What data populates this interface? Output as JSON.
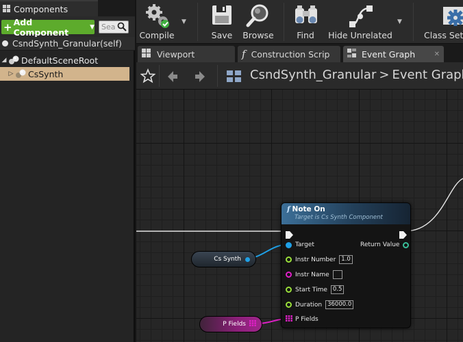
{
  "components_panel": {
    "tab_label": "Components",
    "add_button_label": "Add Component",
    "search_placeholder": "Sea",
    "self_row_label": "CsndSynth_Granular(self)",
    "tree": [
      {
        "label": "DefaultSceneRoot"
      },
      {
        "label": "CsSynth",
        "selected": true
      }
    ]
  },
  "toolbar": {
    "buttons": [
      {
        "label": "Compile",
        "icon": "compile-gears-icon"
      },
      {
        "label": "Save",
        "icon": "floppy-disk-icon"
      },
      {
        "label": "Browse",
        "icon": "magnifier-icon"
      },
      {
        "label": "Find",
        "icon": "binoculars-icon"
      },
      {
        "label": "Hide Unrelated",
        "icon": "graph-nodes-icon"
      },
      {
        "label": "Class Setti",
        "icon": "gear-icon"
      }
    ]
  },
  "tabs": [
    {
      "label": "Viewport"
    },
    {
      "label": "Construction Scrip"
    },
    {
      "label": "Event Graph",
      "active": true
    }
  ],
  "graph_header": {
    "blueprint_name": "CsndSynth_Granular",
    "separator": ">",
    "graph_name": "Event Graph"
  },
  "node": {
    "title": "Note On",
    "subtitle": "Target is Cs Synth Component",
    "pins": {
      "target": "Target",
      "return_value": "Return Value",
      "instr_number": {
        "label": "Instr Number",
        "value": "1.0"
      },
      "instr_name": {
        "label": "Instr Name",
        "value": ""
      },
      "start_time": {
        "label": "Start Time",
        "value": "0.5"
      },
      "duration": {
        "label": "Duration",
        "value": "36000.0"
      },
      "p_fields": "P Fields"
    }
  },
  "variables": {
    "cs_synth": "Cs Synth",
    "p_fields": "P Fields"
  },
  "colors": {
    "add_button": "#5dab2c",
    "selection": "#d2b48c",
    "object_pin": "#1fa0e6",
    "float_pin": "#9ae03a",
    "string_pin": "#e020c8",
    "array_pin": "#e020c8"
  }
}
